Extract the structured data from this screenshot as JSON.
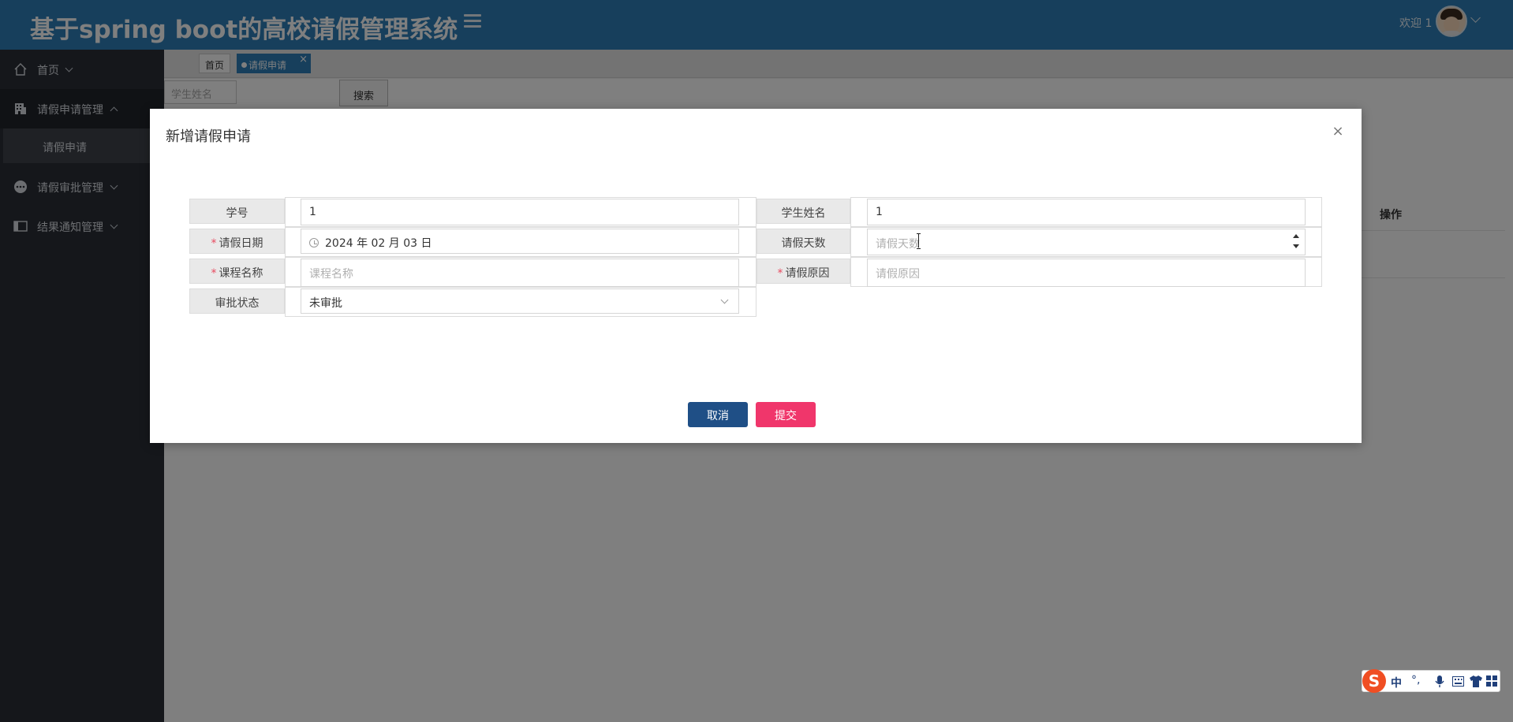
{
  "header": {
    "app_title": "基于spring boot的高校请假管理系统",
    "welcome": "欢迎 1"
  },
  "sidebar": {
    "items": [
      {
        "label": "首页"
      },
      {
        "label": "请假申请管理"
      },
      {
        "label": "请假审批管理"
      },
      {
        "label": "结果通知管理"
      }
    ],
    "sub_items": [
      {
        "label": "请假申请"
      }
    ]
  },
  "tabs": {
    "home": "首页",
    "active": "请假申请",
    "close": "×"
  },
  "content": {
    "search_placeholder": "学生姓名",
    "search_button": "搜索",
    "table_op_header": "操作"
  },
  "modal": {
    "title": "新增请假申请",
    "close": "×",
    "fields": {
      "student_id": {
        "label": "学号",
        "value": "1"
      },
      "student_name": {
        "label": "学生姓名",
        "value": "1"
      },
      "leave_date": {
        "label": "请假日期",
        "value": "2024 年 02 月 03 日"
      },
      "leave_days": {
        "label": "请假天数",
        "placeholder": "请假天数"
      },
      "course_name": {
        "label": "课程名称",
        "placeholder": "课程名称"
      },
      "leave_reason": {
        "label": "请假原因",
        "placeholder": "请假原因"
      },
      "approval_status": {
        "label": "审批状态",
        "value": "未审批"
      }
    },
    "required_mark": "*",
    "cancel": "取消",
    "submit": "提交"
  },
  "ime": {
    "logo": "S",
    "mode": "中",
    "punct": "°,"
  },
  "colors": {
    "header": "#2e7fb8",
    "sidebar": "#2b2f36",
    "cancel_button": "#1f4f86",
    "submit_button": "#f0366b",
    "required": "#e84a5f"
  }
}
